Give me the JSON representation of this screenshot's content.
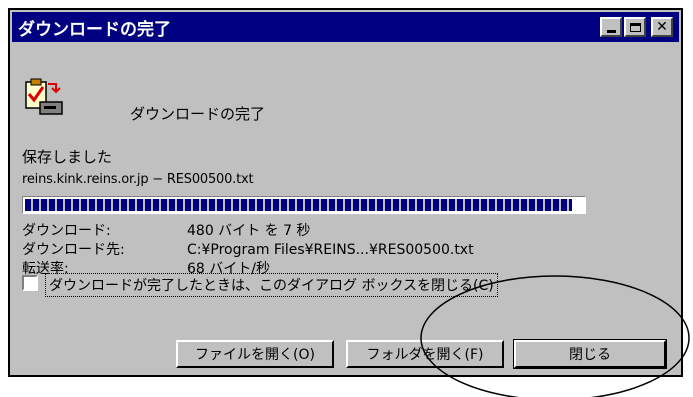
{
  "window": {
    "title": "ダウンロードの完了"
  },
  "dialog": {
    "header": "ダウンロードの完了",
    "status": "保存しました",
    "file_line": "reins.kink.reins.or.jp − RES00500.txt",
    "progress_fraction": 0.98,
    "info": [
      {
        "label": "ダウンロード:",
        "value": "480 バイト を  7 秒"
      },
      {
        "label": "ダウンロード先:",
        "value": "C:¥Program Files¥REINS...¥RES00500.txt"
      },
      {
        "label": "転送率:",
        "value": "68 バイト/秒"
      }
    ],
    "checkbox_label": "ダウンロードが完了したときは、このダイアログ ボックスを閉じる(C)",
    "buttons": {
      "open_file": "ファイルを開く(O)",
      "open_folder": "フォルダを開く(F)",
      "close": "閉じる"
    }
  },
  "icons": {
    "download_complete": "clipboard-check-icon",
    "minimize": "minimize-icon",
    "maximize": "maximize-icon",
    "close": "close-icon"
  },
  "colors": {
    "titlebar": "#000080",
    "progress": "#000080",
    "dialog_bg": "#c0c0c0"
  }
}
